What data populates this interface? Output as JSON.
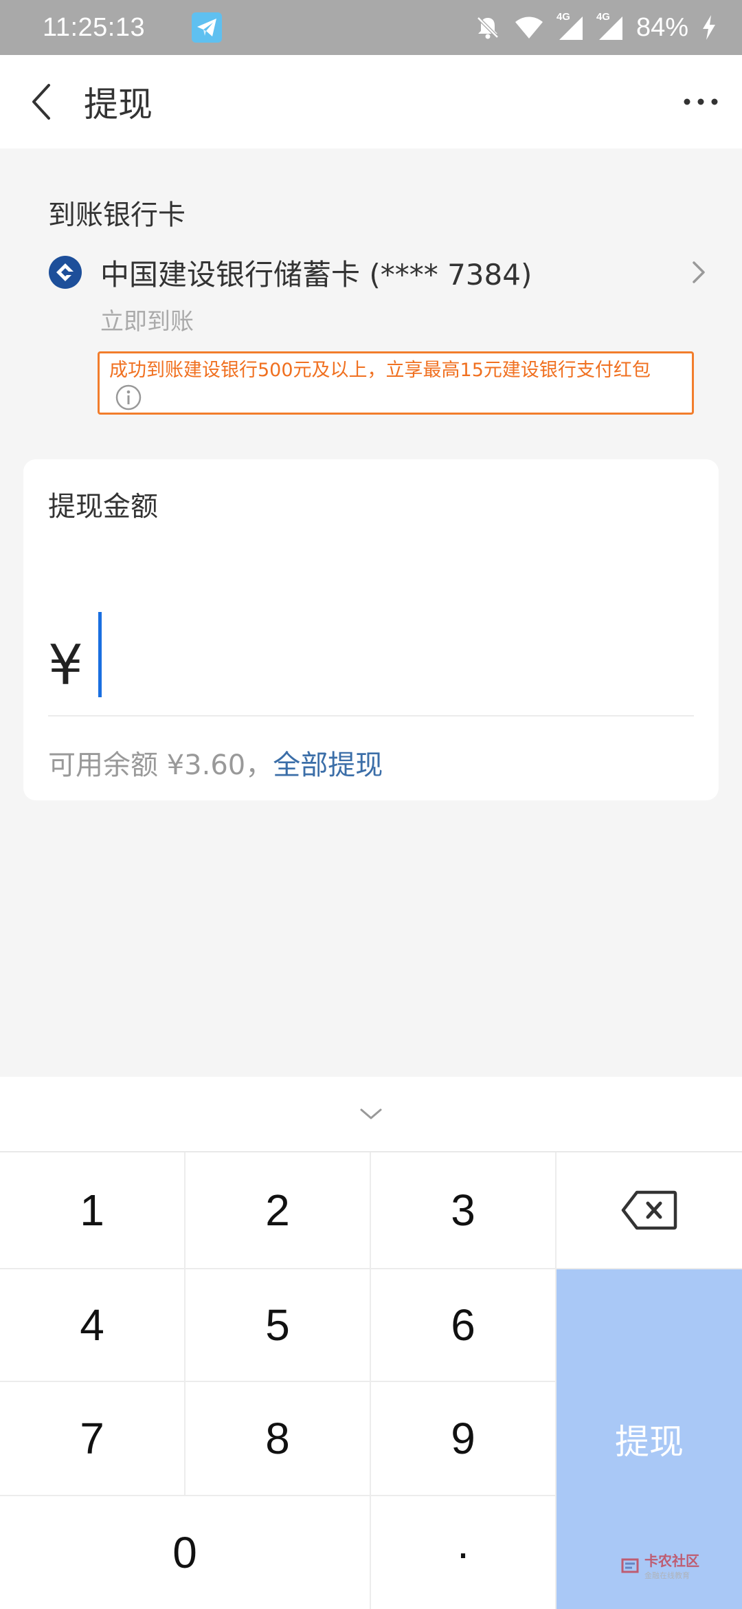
{
  "status_bar": {
    "time": "11:25:13",
    "battery": "84%",
    "network_a": "4G",
    "network_b": "4G",
    "icons": [
      "telegram-icon",
      "bell-off-icon",
      "wifi-icon",
      "signal-icon",
      "signal-icon",
      "charging-icon"
    ]
  },
  "header": {
    "title": "提现",
    "back_icon": "chevron-left-icon",
    "more_icon": "more-dots-icon"
  },
  "bank": {
    "section_label": "到账银行卡",
    "bank_name": "中国建设银行储蓄卡 (**** 7384)",
    "arrival": "立即到账",
    "promo": "成功到账建设银行500元及以上，立享最高15元建设银行支付红包",
    "logo_color": "#1d4f9a",
    "promo_color": "#f07020"
  },
  "amount": {
    "label": "提现金额",
    "currency": "¥",
    "balance_text": "可用余额 ¥3.60，",
    "withdraw_all": "全部提现",
    "cursor_color": "#1a6fe0"
  },
  "keyboard": {
    "keys": [
      "1",
      "2",
      "3",
      "4",
      "5",
      "6",
      "7",
      "8",
      "9",
      "0",
      "·"
    ],
    "submit_label": "提现",
    "submit_color": "#a9c8f6",
    "backspace_icon": "backspace-icon",
    "collapse_icon": "chevron-down-icon"
  },
  "watermark": {
    "title": "卡农社区",
    "subtitle": "金融在线教育"
  }
}
